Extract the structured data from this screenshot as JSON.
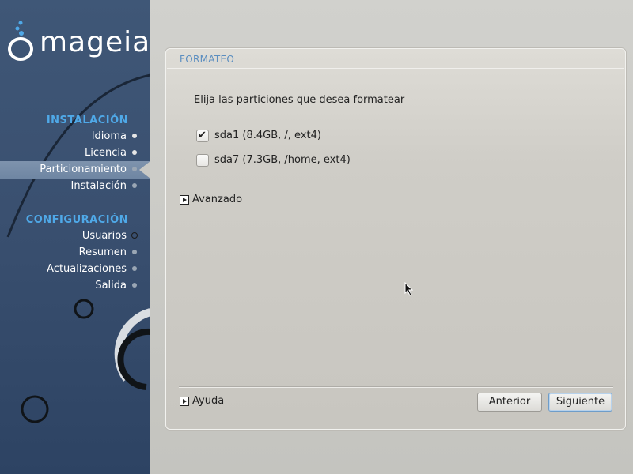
{
  "brand": {
    "logo_text": "mageia"
  },
  "sidebar": {
    "section_install": "INSTALACIÓN",
    "section_config": "CONFIGURACIÓN",
    "install_items": [
      {
        "label": "Idioma",
        "state": "done"
      },
      {
        "label": "Licencia",
        "state": "done"
      },
      {
        "label": "Particionamiento",
        "state": "current"
      },
      {
        "label": "Instalación",
        "state": "pending"
      }
    ],
    "config_items": [
      {
        "label": "Usuarios",
        "state": "pending"
      },
      {
        "label": "Resumen",
        "state": "pending"
      },
      {
        "label": "Actualizaciones",
        "state": "pending"
      },
      {
        "label": "Salida",
        "state": "pending"
      }
    ]
  },
  "dialog": {
    "title": "FORMATEO",
    "instruction": "Elija las particiones que desea formatear",
    "partitions": [
      {
        "label": "sda1 (8.4GB, /, ext4)",
        "checked": true
      },
      {
        "label": "sda7 (7.3GB, /home, ext4)",
        "checked": false
      }
    ],
    "advanced_label": "Avanzado",
    "help_label": "Ayuda",
    "buttons": {
      "previous": "Anterior",
      "next": "Siguiente"
    }
  },
  "colors": {
    "sidebar_bg": "#3a5070",
    "section_title": "#4fa9e8",
    "panel_title": "#5b8ec0"
  },
  "icons": {
    "checkbox_checked": "check-icon",
    "expander": "expander-triangle-icon",
    "cursor": "mouse-pointer-icon"
  }
}
